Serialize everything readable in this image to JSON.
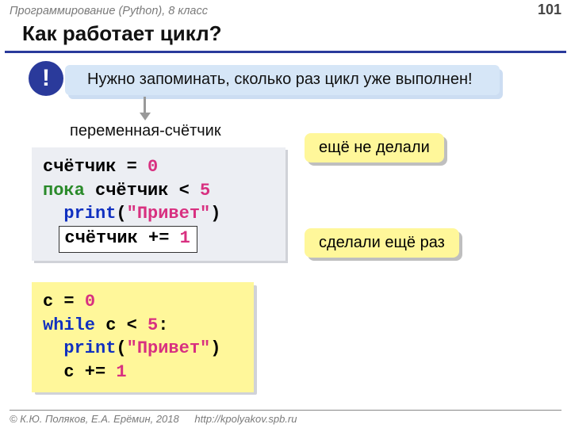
{
  "header": {
    "course": "Программирование (Python), 8 класс",
    "page": "101",
    "title": "Как работает цикл?"
  },
  "notice": {
    "badge": "!",
    "text": "Нужно запоминать, сколько раз цикл уже выполнен!"
  },
  "counter_label": "переменная-счётчик",
  "pseudo": {
    "l1a": "счётчик = ",
    "l1b": "0",
    "l2a": "пока ",
    "l2b": "счётчик < ",
    "l2c": "5",
    "l3a": "  ",
    "l3b": "print",
    "l3c": "(",
    "l3d": "\"Привет\"",
    "l3e": ")",
    "l4a": "  ",
    "l4b": "счётчик += ",
    "l4c": "1"
  },
  "callouts": {
    "not_yet": "ещё не делали",
    "did_once": "сделали ещё раз"
  },
  "python": {
    "l1a": "c = ",
    "l1b": "0",
    "l2a": "while",
    "l2b": " c < ",
    "l2c": "5",
    "l2d": ":",
    "l3a": "  ",
    "l3b": "print",
    "l3c": "(",
    "l3d": "\"Привет\"",
    "l3e": ")",
    "l4a": "  c += ",
    "l4b": "1"
  },
  "footer": {
    "copyright": "© К.Ю. Поляков, Е.А. Ерёмин, 2018",
    "url": "http://kpolyakov.spb.ru"
  }
}
